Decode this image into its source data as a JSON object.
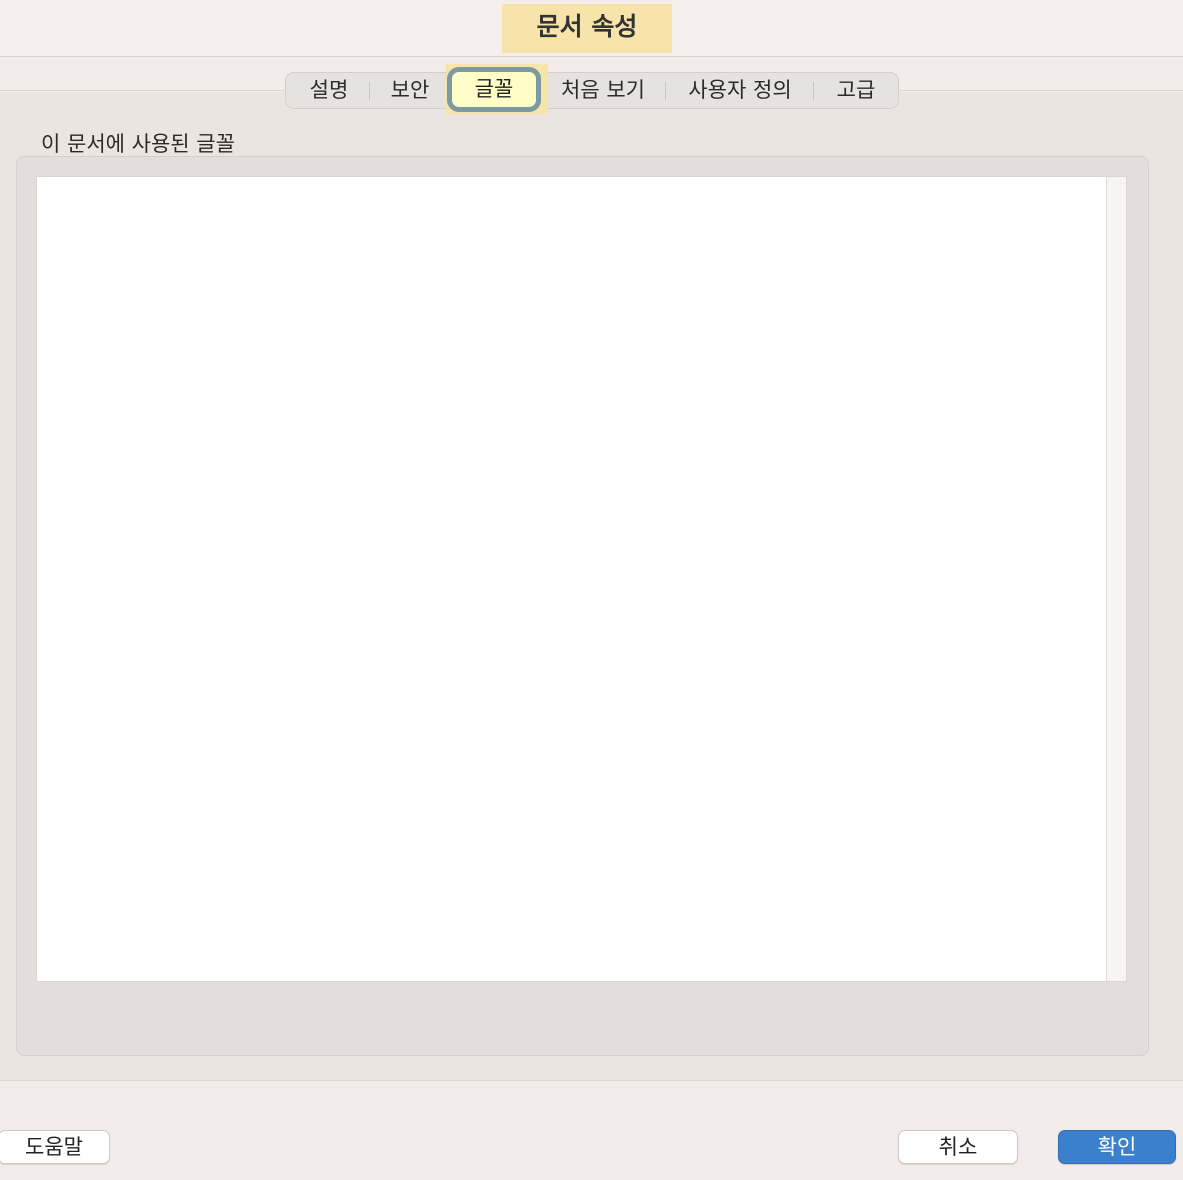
{
  "window": {
    "title": "문서 속성"
  },
  "tabs": [
    {
      "label": "설명"
    },
    {
      "label": "보안"
    },
    {
      "label": "글꼴",
      "selected": true
    },
    {
      "label": "처음 보기"
    },
    {
      "label": "사용자 정의"
    },
    {
      "label": "고급"
    }
  ],
  "fonts_panel": {
    "heading": "이 문서에 사용된 글꼴",
    "items": []
  },
  "buttons": {
    "help": "도움말",
    "cancel": "취소",
    "ok": "확인"
  },
  "colors": {
    "accent": "#3b80cc",
    "highlight": "#f6e4aa",
    "selected_tab_border": "#7d9aa1"
  }
}
